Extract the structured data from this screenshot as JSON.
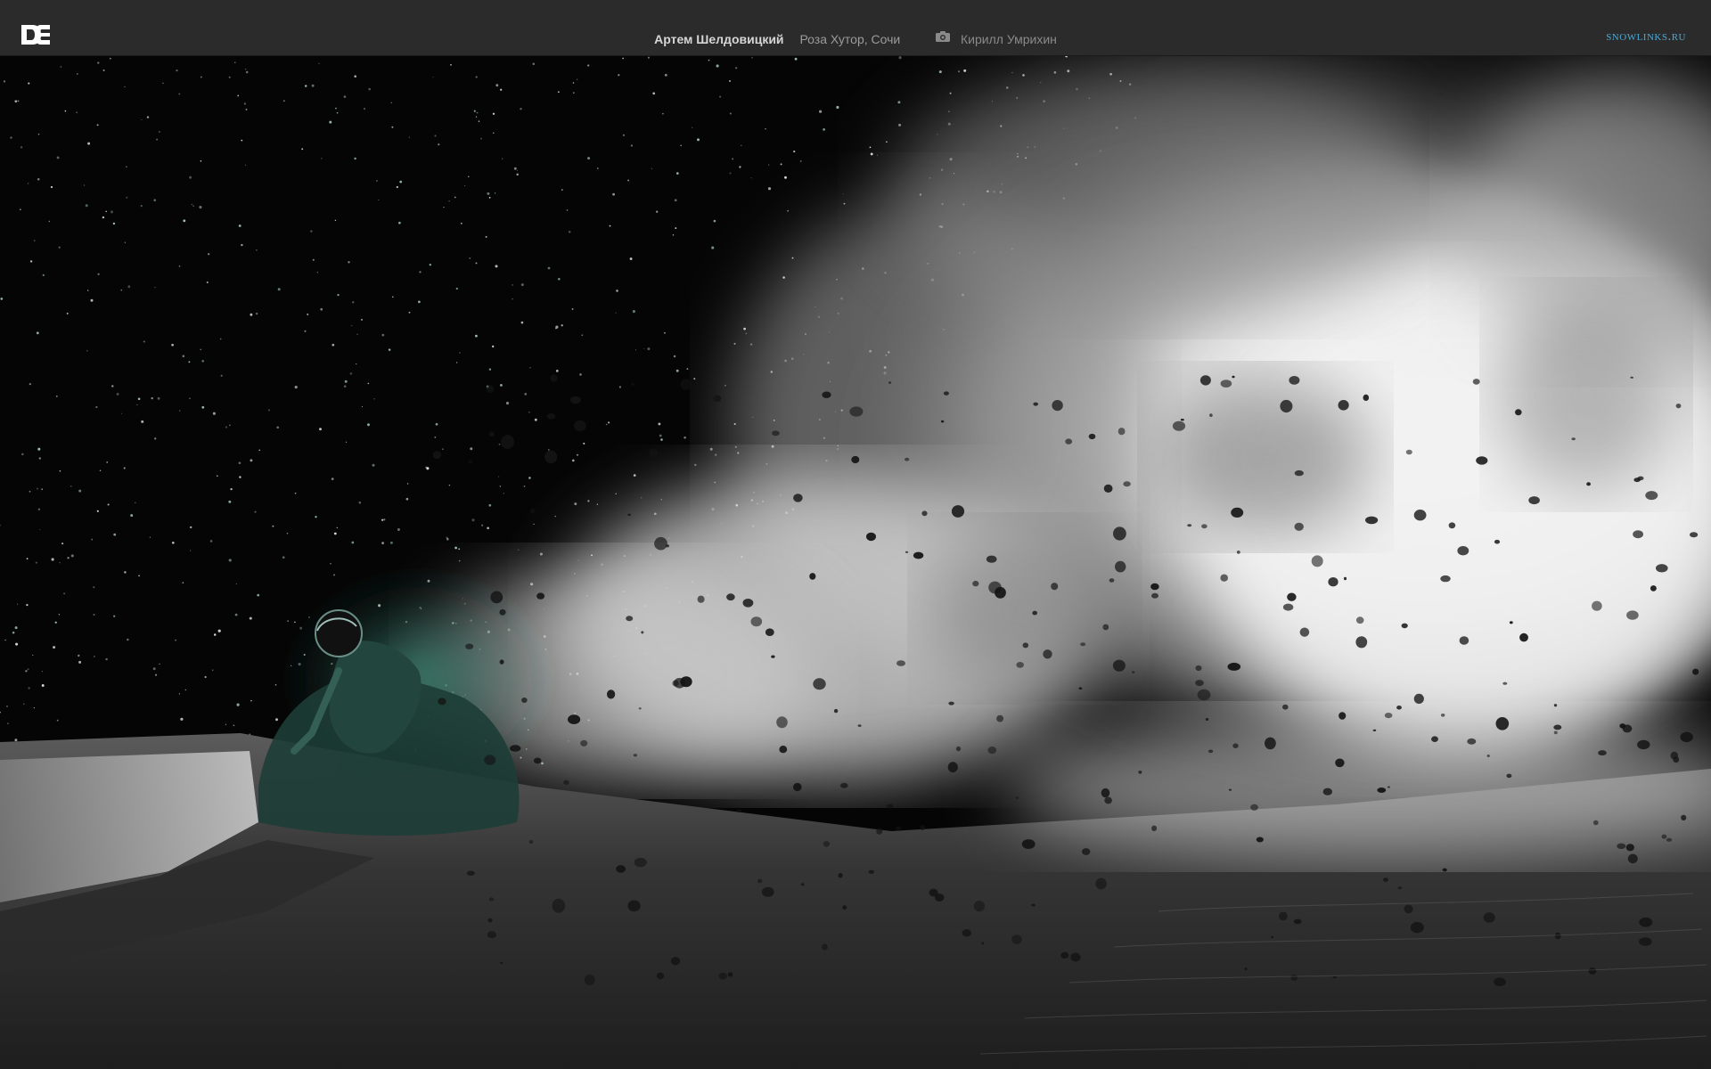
{
  "header": {
    "logo": "DC",
    "rider": "Артем Шелдовицкий",
    "location": "Роза Хутор, Сочи",
    "camera_icon": "camera-icon",
    "photographer": "Кирилл Умрихин",
    "brand": "snowlinks.ru"
  },
  "photo": {
    "subject": "snowboarder-powder-spray-night",
    "colors": {
      "sky": "#050505",
      "snow_cloud": "#e8e8e8",
      "rider_glow": "#2f6b5e",
      "ground": "#3a3a3a"
    }
  }
}
